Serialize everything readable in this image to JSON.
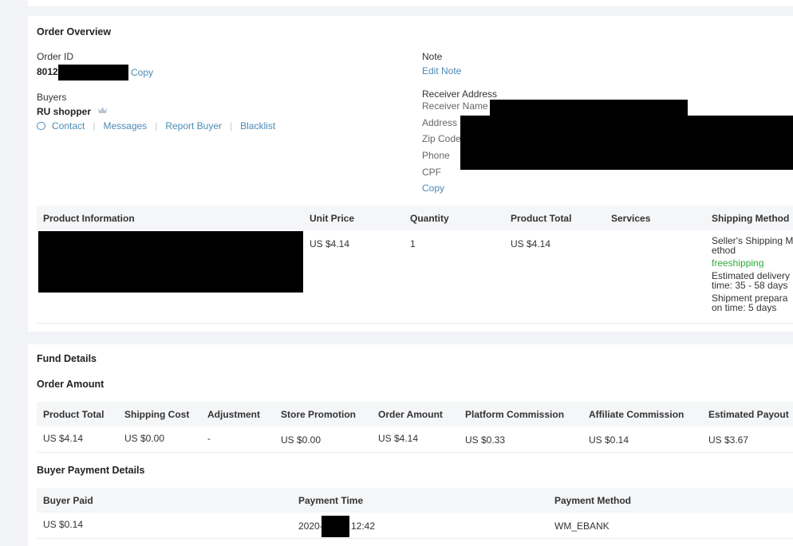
{
  "overview": {
    "title": "Order Overview",
    "order_id_label": "Order ID",
    "order_id_value": "8012",
    "copy_label": "Copy",
    "buyers_label": "Buyers",
    "buyer_name": "RU shopper",
    "links": {
      "contact": "Contact",
      "messages": "Messages",
      "report": "Report Buyer",
      "blacklist": "Blacklist"
    },
    "note_label": "Note",
    "edit_note": "Edit Note",
    "receiver_address_label": "Receiver Address",
    "receiver_name_label": "Receiver Name",
    "address_label": "Address",
    "zip_label": "Zip Code",
    "phone_label": "Phone",
    "cpf_label": "CPF",
    "copy2_label": "Copy"
  },
  "product_table": {
    "headers": [
      "Product Information",
      "Unit Price",
      "Quantity",
      "Product Total",
      "Services",
      "Shipping Method"
    ],
    "row": {
      "unit_price": "US $4.14",
      "quantity": "1",
      "product_total": "US $4.14",
      "shipping": [
        "Seller's Shipping M",
        "ethod",
        "freeshipping",
        "Estimated delivery",
        "time: 35 - 58 days",
        "Shipment prepara",
        "on time: 5 days"
      ]
    }
  },
  "fund": {
    "title": "Fund Details",
    "order_amount_title": "Order Amount",
    "headers": [
      "Product Total",
      "Shipping Cost",
      "Adjustment",
      "Store Promotion",
      "Order Amount",
      "Platform Commission",
      "Affiliate Commission",
      "Estimated Payout"
    ],
    "values": [
      "US $4.14",
      "US $0.00",
      "-",
      "US $0.00",
      "US $4.14",
      "US $0.33",
      "US $0.14",
      "US $3.67"
    ],
    "payment_title": "Buyer Payment Details",
    "payment_headers": [
      "Buyer Paid",
      "Payment Time",
      "Payment Method"
    ],
    "payment_values": {
      "paid": "US $0.14",
      "time_prefix": "2020-",
      "time_suffix": "12:42",
      "method": "WM_EBANK"
    }
  }
}
